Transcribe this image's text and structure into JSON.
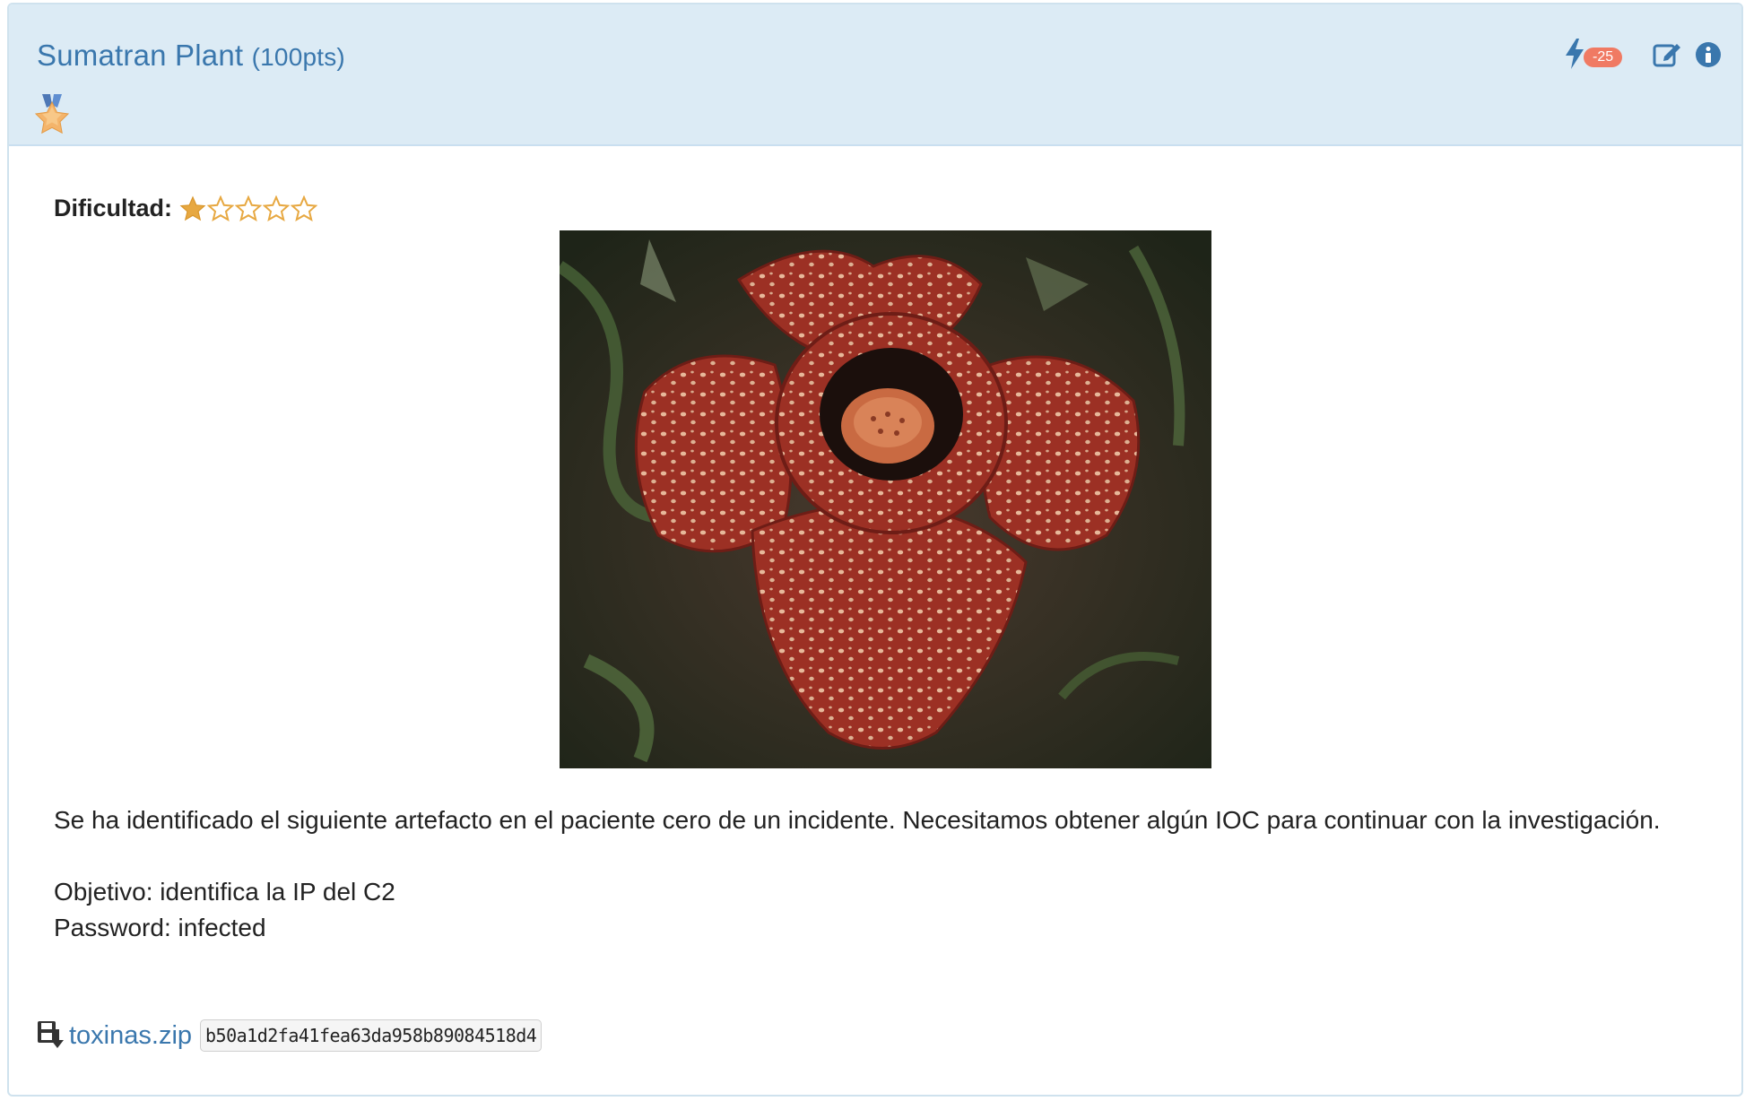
{
  "challenge": {
    "title": "Sumatran Plant",
    "points": "(100pts)",
    "penalty": "-25",
    "icons": {
      "medal": "medal-star-icon",
      "hint": "bolt-icon",
      "edit": "edit-icon",
      "info": "info-icon"
    }
  },
  "difficulty": {
    "label": "Dificultad:",
    "rating": 1,
    "max": 5
  },
  "image": {
    "subject": "rafflesia-flower"
  },
  "description": {
    "line1": "Se ha identificado el siguiente artefacto en el paciente cero de un incidente. Necesitamos obtener algún IOC para continuar con la investigación.",
    "objective": "Objetivo: identifica la IP del C2",
    "password": "Password: infected"
  },
  "file": {
    "name": "toxinas.zip",
    "hash": "b50a1d2fa41fea63da958b89084518d4"
  },
  "colors": {
    "header_bg": "#dcebf5",
    "link": "#3a77ad",
    "star": "#e7a841",
    "badge": "#f07a63"
  }
}
